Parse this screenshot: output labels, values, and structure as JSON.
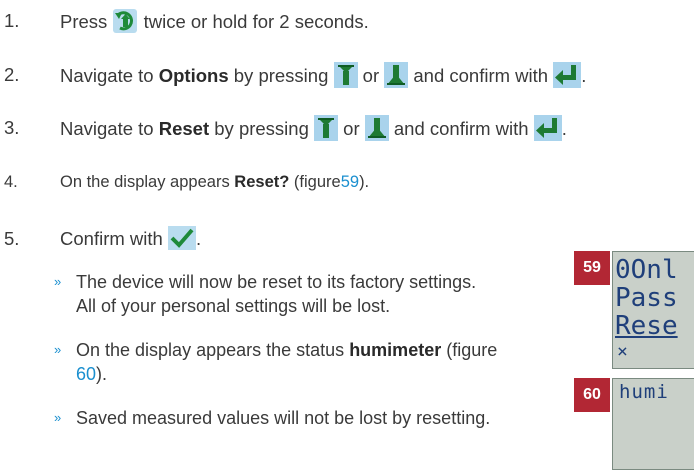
{
  "steps": [
    {
      "num": "1.",
      "pre": "Press",
      "post": "twice or hold for 2 seconds."
    },
    {
      "num": "2.",
      "pre": "Navigate to",
      "bold": "Options",
      "mid": "by pressing",
      "or": "or",
      "post": "and confirm with",
      "end": "."
    },
    {
      "num": "3.",
      "pre": "Navigate to",
      "bold": "Reset",
      "mid": "by pressing",
      "or": "or",
      "post": "and confirm with",
      "end": "."
    },
    {
      "num": "4.",
      "pre": "On the display appears",
      "bold": "Reset?",
      "fig_pre": "(figure",
      "fig": "59",
      "fig_post": ")."
    },
    {
      "num": "5.",
      "pre": "Confirm with",
      "end": "."
    }
  ],
  "results": [
    {
      "arrow": "»",
      "lines": [
        "The device will now be reset to its factory settings.",
        "All of your personal settings will be lost."
      ]
    },
    {
      "arrow": "»",
      "pre": "On the display appears the status",
      "bold": "humimeter",
      "fig_pre": "(figure",
      "fig": "60",
      "fig_post": ")."
    },
    {
      "arrow": "»",
      "lines": [
        "Saved measured values will not be lost by resetting."
      ]
    }
  ],
  "figures": [
    {
      "label": "59",
      "lcd_lines": [
        "0Onl",
        "Pass",
        "Rese",
        "×"
      ]
    },
    {
      "label": "60",
      "lcd_lines": [
        "humi"
      ]
    }
  ],
  "icons": [
    "menu-key-icon",
    "down-arrow-key-icon",
    "up-arrow-key-icon",
    "enter-key-icon",
    "check-key-icon"
  ],
  "colors": {
    "text": "#3a3a3a",
    "link": "#1a8fcf",
    "badge": "#b22734",
    "lcd_bg": "#c9d0c9",
    "lcd_text": "#1f3f7a"
  }
}
